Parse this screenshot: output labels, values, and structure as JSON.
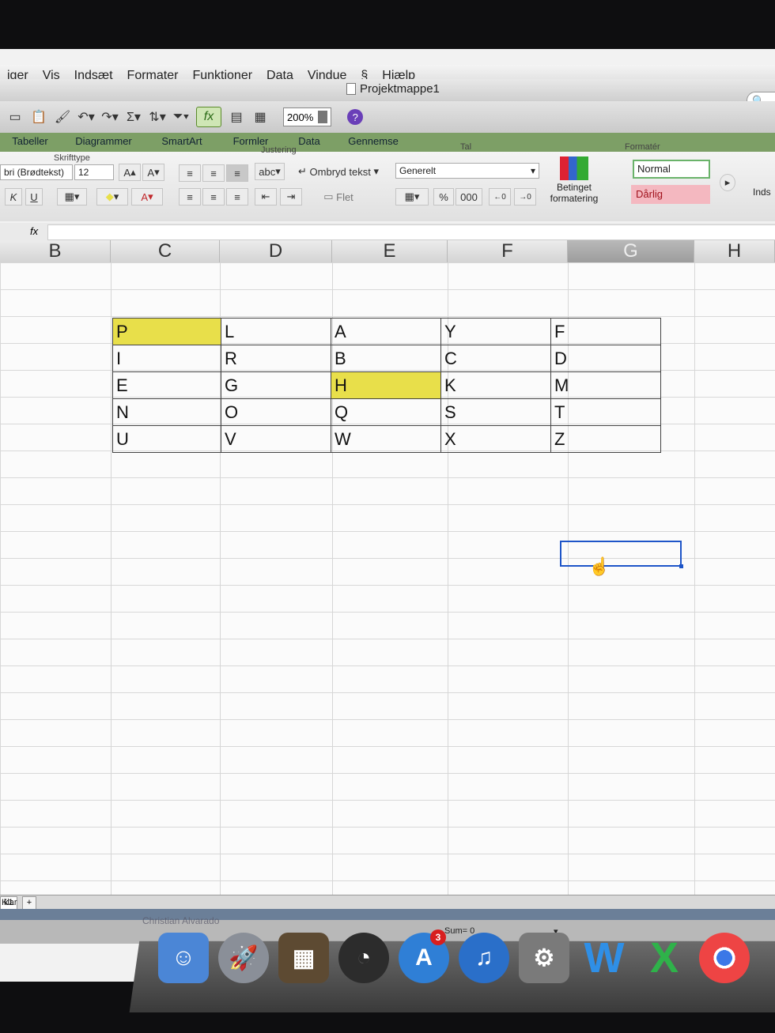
{
  "menubar": {
    "items": [
      "iger",
      "Vis",
      "Indsæt",
      "Formater",
      "Funktioner",
      "Data",
      "Vindue",
      "Hjælp"
    ]
  },
  "window": {
    "title": "Projektmappe1",
    "zoom": "200%"
  },
  "ribbon": {
    "tabs": [
      "Tabeller",
      "Diagrammer",
      "SmartArt",
      "Formler",
      "Data",
      "Gennemse"
    ],
    "groups": {
      "font": "Skrifttype",
      "alignment": "Justering",
      "number": "Tal",
      "format": "Formatér"
    },
    "font_name": "bri (Brødtekst)",
    "font_size": "12",
    "wrap_text": "Ombryd tekst",
    "merge": "Flet",
    "abc": "abc",
    "number_format": "Generelt",
    "percent": "%",
    "thousands": "000",
    "conditional_formatting_line1": "Betinget",
    "conditional_formatting_line2": "formatering",
    "style_normal": "Normal",
    "style_bad": "Dårlig",
    "insert": "Inds",
    "font_grow": "A",
    "font_shrink": "A",
    "italic": "K",
    "underline": "U"
  },
  "formula_bar": {
    "fx": "fx"
  },
  "columns": [
    "B",
    "C",
    "D",
    "E",
    "F",
    "G",
    "H"
  ],
  "selected_column": "G",
  "sheet": {
    "table": [
      [
        "P",
        "L",
        "A",
        "Y",
        "F"
      ],
      [
        "I",
        "R",
        "B",
        "C",
        "D"
      ],
      [
        "E",
        "G",
        "H",
        "K",
        "M"
      ],
      [
        "N",
        "O",
        "Q",
        "S",
        "T"
      ],
      [
        "U",
        "V",
        "W",
        "X",
        "Z"
      ]
    ],
    "highlighted_cells": [
      "P",
      "H"
    ],
    "highlight_color": "#e8df4a"
  },
  "sheet_tabs": {
    "tab": "k1",
    "add": "+"
  },
  "status": {
    "ready": "Klar",
    "sum": "Sum= 0",
    "notice": "Christian Alvarado"
  },
  "dock": {
    "items": [
      "finder-icon",
      "launchpad-icon",
      "photo-icon",
      "dashboard-icon",
      "app-store-icon",
      "itunes-icon",
      "system-preferences-icon",
      "word-icon",
      "excel-icon",
      "chrome-icon"
    ],
    "app_store_badge": "3"
  }
}
